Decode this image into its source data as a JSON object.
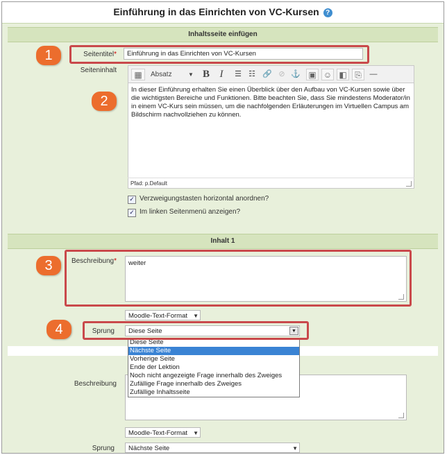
{
  "page": {
    "title": "Einführung in das Einrichten von VC-Kursen",
    "help_glyph": "?"
  },
  "section1": {
    "heading": "Inhaltsseite einfügen",
    "seitentitel_label": "Seitentitel",
    "required_mark": "*",
    "seitentitel_value": "Einführung in das Einrichten von VC-Kursen",
    "seiteninhalt_label": "Seiteninhalt",
    "format_select": "Absatz",
    "bold": "B",
    "italic": "I",
    "content": "In dieser Einführung erhalten Sie einen Überblick über den Aufbau von VC-Kursen sowie über die wichtigsten Bereiche und Funktionen. Bitte beachten Sie, dass Sie mindestens Moderator/in in einem VC-Kurs sein müssen, um die nachfolgenden Erläuterungen im Virtuellen Campus am Bildschirm nachvollziehen zu können.",
    "path": "Pfad: p.Default",
    "checkbox1": "Verzweigungstasten horizontal anordnen?",
    "checkbox2": "Im linken Seitenmenü anzeigen?",
    "checkbox1_checked": true,
    "checkbox2_checked": true
  },
  "section2": {
    "heading": "Inhalt 1",
    "beschreibung_label": "Beschreibung",
    "beschreibung_value": "weiter",
    "format_select": "Moodle-Text-Format",
    "sprung_label": "Sprung",
    "sprung_value": "Diese Seite",
    "sprung_options": [
      "Diese Seite",
      "Nächste Seite",
      "Vorherige Seite",
      "Ende der Lektion",
      "Noch nicht angezeigte Frage innerhalb des Zweiges",
      "Zufällige Frage innerhalb des Zweiges",
      "Zufällige Inhaltsseite"
    ],
    "highlighted_option": "Nächste Seite"
  },
  "section3": {
    "beschreibung_label": "Beschreibung",
    "format_select": "Moodle-Text-Format",
    "sprung_label": "Sprung",
    "sprung_value": "Nächste Seite"
  },
  "badges": [
    "1",
    "2",
    "3",
    "4"
  ],
  "colors": {
    "background": "#e8f0db",
    "section_bar": "#d6e4be",
    "highlight_box": "#c9494b",
    "badge": "#ec6d2d",
    "selected_option": "#3a83d4"
  }
}
